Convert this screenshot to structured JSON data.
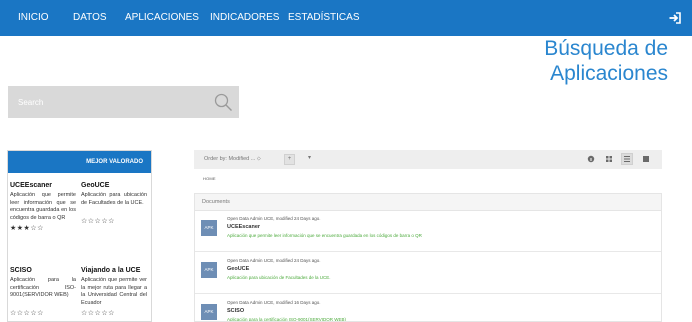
{
  "nav": {
    "items": [
      "INICIO",
      "DATOS",
      "APLICACIONES",
      "INDICADORES",
      "ESTADÍSTICAS"
    ]
  },
  "title": {
    "line1": "Búsqueda de",
    "line2": "Aplicaciones"
  },
  "search": {
    "placeholder": "Search"
  },
  "left_panel": {
    "header": "MEJOR VALORADO",
    "apps": [
      {
        "name": "UCEEscaner",
        "desc": "Aplicación que permite leer información que se encuentra guardada en los códigos de barra o QR",
        "stars": "★★★☆☆"
      },
      {
        "name": "GeoUCE",
        "desc": "Aplicación para ubicación de Facultades de la UCE.",
        "stars": "☆☆☆☆☆"
      },
      {
        "name": "SCISO",
        "desc": "Aplicación para la certificación ISO-9001(SERVIDOR WEB)",
        "stars": "☆☆☆☆☆"
      },
      {
        "name": "Viajando a la UCE",
        "desc": "Aplicación que permite ver la mejor ruta para llegar a la Universidad Central del Ecuador",
        "stars": "☆☆☆☆☆"
      }
    ]
  },
  "toolbar": {
    "order_label": "Order by: Modified ... ⬦",
    "plus": "+",
    "dropdown": "▾"
  },
  "breadcrumb": "HOME",
  "documents": {
    "header": "Documents",
    "items": [
      {
        "icon": "APK",
        "meta": "Open Data Admin UCE, modified 24 Days ago.",
        "title": "UCEEscaner",
        "desc": "Aplicación que permite leer información que se encuentra guardada en los códigos de barra o QR"
      },
      {
        "icon": "APK",
        "meta": "Open Data Admin UCE, modified 24 Days ago.",
        "title": "GeoUCE",
        "desc": "Aplicación para ubicación de Facultades de la UCE."
      },
      {
        "icon": "APK",
        "meta": "Open Data Admin UCE, modified 16 Days ago.",
        "title": "SCISO",
        "desc": "Aplicación para la certificación ISO-9001(SERVIDOR WEB)"
      }
    ]
  },
  "colors": {
    "nav_bg": "#1a76c4",
    "title": "#2a86cf",
    "desc_green": "#4caa3c"
  }
}
